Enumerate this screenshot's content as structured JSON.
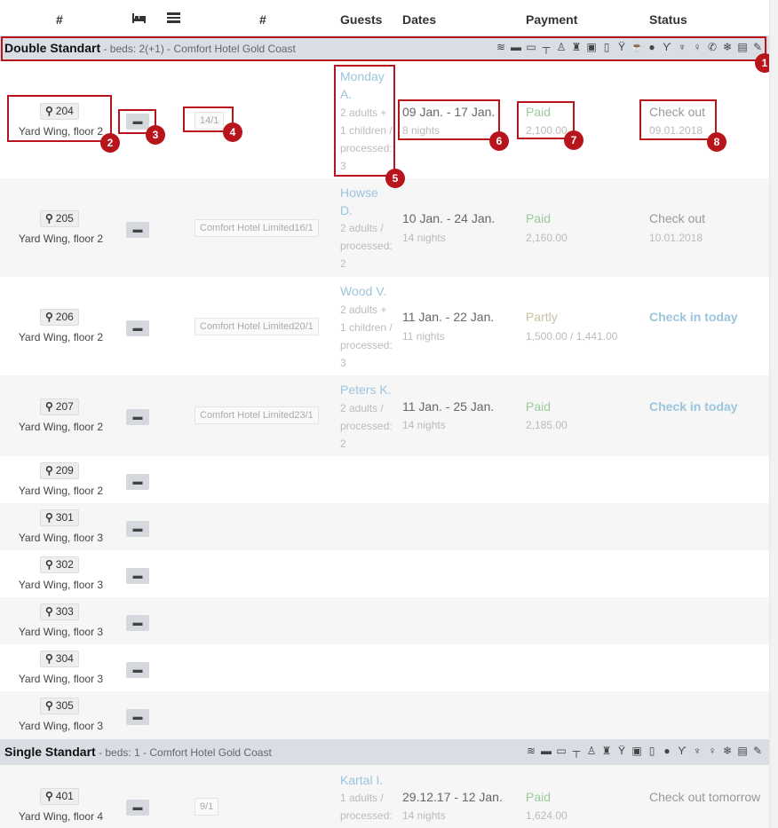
{
  "header": {
    "col_hash": "#",
    "col_hash2": "#",
    "guests": "Guests",
    "dates": "Dates",
    "payment": "Payment",
    "status": "Status"
  },
  "groups": [
    {
      "name": "Double Standart",
      "sep": " - ",
      "meta": "beds: 2(+1) - Comfort Hotel Gold Coast"
    },
    {
      "name": "Single Standart",
      "sep": " - ",
      "meta": "beds: 1 - Comfort Hotel Gold Coast"
    }
  ],
  "amenities": [
    "wifi-icon",
    "bed-icon",
    "tv-icon",
    "table-icon",
    "hanger-icon",
    "coat-icon",
    "safe-icon",
    "fridge-icon",
    "wine-icon",
    "kettle-icon",
    "fruit-icon",
    "hairdryer-icon",
    "shower-icon",
    "toilet-icon",
    "phone-icon",
    "aircon-icon",
    "window-icon",
    "wrench-icon"
  ],
  "rooms": [
    {
      "room": "204",
      "wing": "Yard Wing, floor 2",
      "tag": "14/1",
      "guest_name": "Monday A.",
      "guest_info": "2 adults + 1 children / processed: 3",
      "dates": "09 Jan. - 17 Jan.",
      "nights": "8 nights",
      "pay": "Paid",
      "pay_amt": "2,100.00",
      "status": "Check out",
      "status_date": "09.01.2018"
    },
    {
      "room": "205",
      "wing": "Yard Wing, floor 2",
      "tag": "Comfort Hotel Limited16/1",
      "guest_name": "Howse D.",
      "guest_info": "2 adults / processed: 2",
      "dates": "10 Jan. - 24 Jan.",
      "nights": "14 nights",
      "pay": "Paid",
      "pay_amt": "2,160.00",
      "status": "Check out",
      "status_date": "10.01.2018"
    },
    {
      "room": "206",
      "wing": "Yard Wing, floor 2",
      "tag": "Comfort Hotel Limited20/1",
      "guest_name": "Wood V.",
      "guest_info": "2 adults + 1 children / processed: 3",
      "dates": "11 Jan. - 22 Jan.",
      "nights": "11 nights",
      "pay": "Partly",
      "pay_amt": "1,500.00 / 1,441.00",
      "status": "Check in today",
      "status_date": ""
    },
    {
      "room": "207",
      "wing": "Yard Wing, floor 2",
      "tag": "Comfort Hotel Limited23/1",
      "guest_name": "Peters K.",
      "guest_info": "2 adults / processed: 2",
      "dates": "11 Jan. - 25 Jan.",
      "nights": "14 nights",
      "pay": "Paid",
      "pay_amt": "2,185.00",
      "status": "Check in today",
      "status_date": ""
    },
    {
      "room": "209",
      "wing": "Yard Wing, floor 2"
    },
    {
      "room": "301",
      "wing": "Yard Wing, floor 3"
    },
    {
      "room": "302",
      "wing": "Yard Wing, floor 3"
    },
    {
      "room": "303",
      "wing": "Yard Wing, floor 3"
    },
    {
      "room": "304",
      "wing": "Yard Wing, floor 3"
    },
    {
      "room": "305",
      "wing": "Yard Wing, floor 3"
    },
    {
      "room": "401",
      "wing": "Yard Wing, floor 4",
      "tag": "9/1",
      "guest_name": "Kartal I.",
      "guest_info": "1 adults / processed:",
      "dates": "29.12.17 - 12 Jan.",
      "nights": "14 nights",
      "pay": "Paid",
      "pay_amt": "1,624.00",
      "status": "Check out tomorrow",
      "status_date": ""
    }
  ],
  "annotations": [
    "1",
    "2",
    "3",
    "4",
    "5",
    "6",
    "7",
    "8"
  ]
}
